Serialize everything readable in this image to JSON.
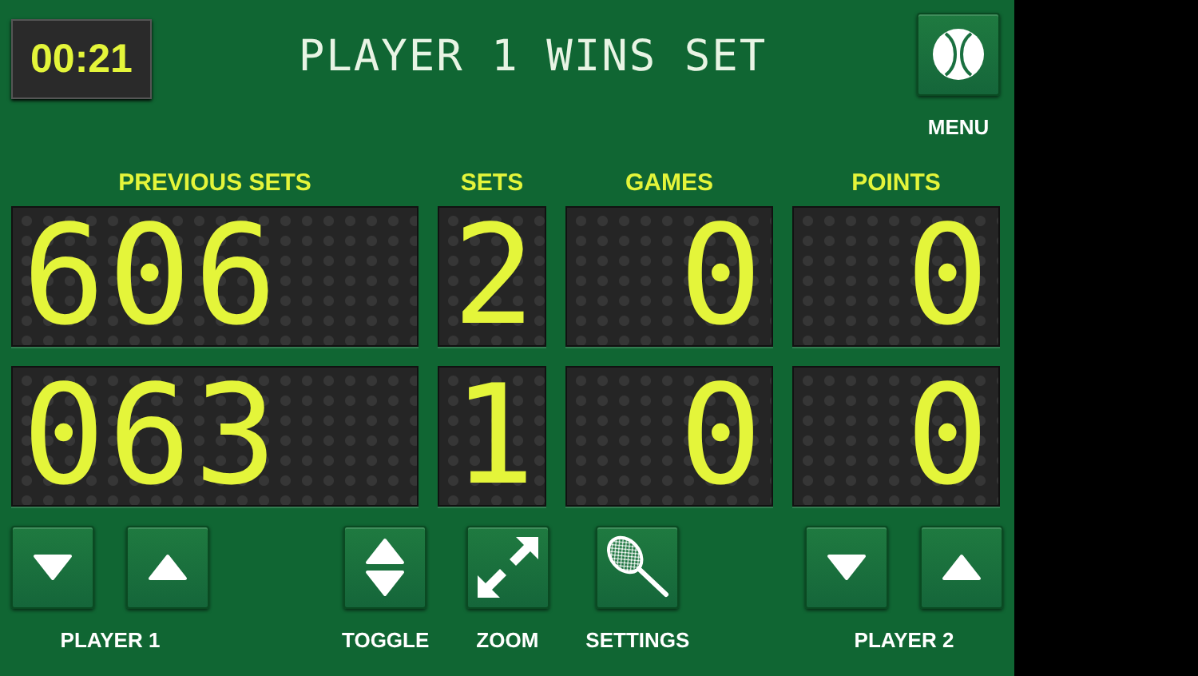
{
  "timer": "00:21",
  "message": "PLAYER 1 WINS SET",
  "menu": {
    "label": "MENU"
  },
  "columns": [
    "PREVIOUS SETS",
    "SETS",
    "GAMES",
    "POINTS"
  ],
  "players": [
    {
      "previous_sets": "606",
      "sets": "2",
      "games": "0",
      "points": "0"
    },
    {
      "previous_sets": "063",
      "sets": "1",
      "games": "0",
      "points": "0"
    }
  ],
  "player_controls": [
    {
      "label": "PLAYER 1"
    },
    {
      "label": "PLAYER 2"
    }
  ],
  "tools": [
    {
      "kind": "toggle",
      "label": "TOGGLE"
    },
    {
      "kind": "zoom",
      "label": "ZOOM"
    },
    {
      "kind": "settings",
      "label": "SETTINGS"
    }
  ]
}
